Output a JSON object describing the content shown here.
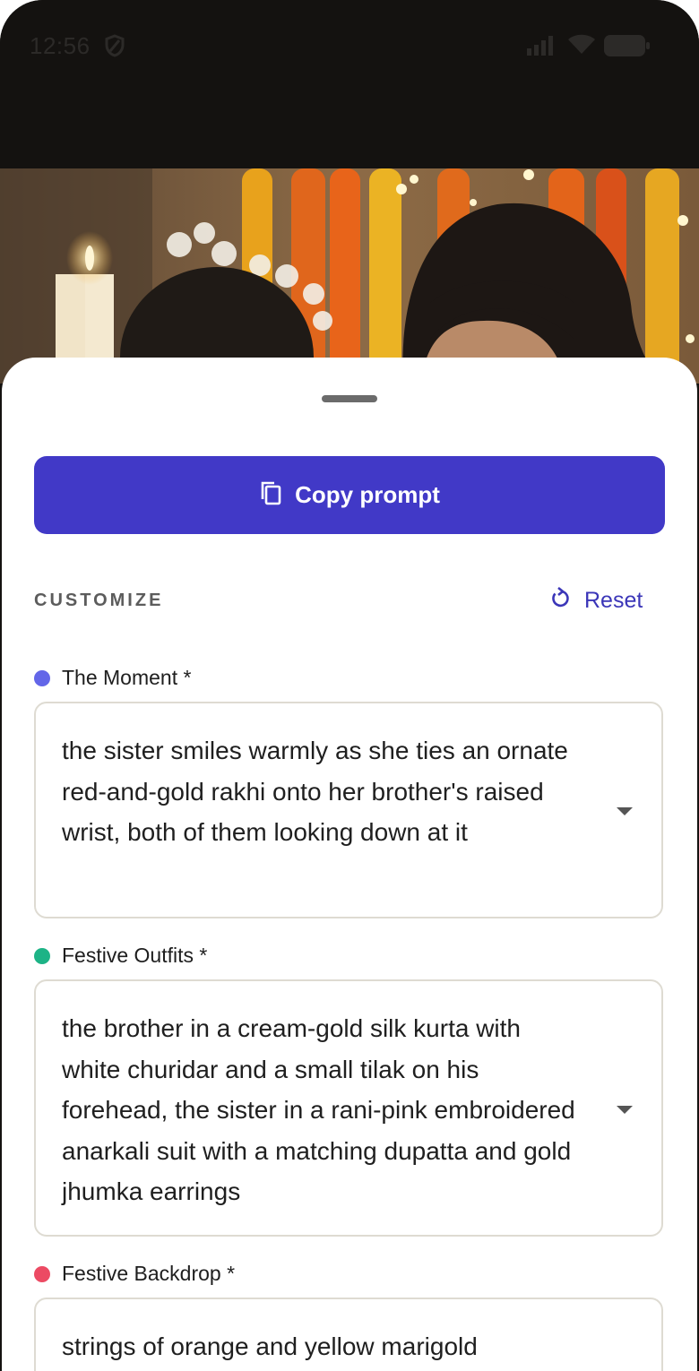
{
  "status": {
    "time": "12:56"
  },
  "actions": {
    "copy_label": "Copy prompt",
    "reset_label": "Reset"
  },
  "section": {
    "title": "CUSTOMIZE"
  },
  "fields": [
    {
      "label": "The Moment *",
      "dot_color": "#6366e8",
      "value": "the sister smiles warmly as she ties an ornate red-and-gold rakhi onto her brother's raised wrist, both of them looking down at it"
    },
    {
      "label": "Festive Outfits *",
      "dot_color": "#1db386",
      "value": "the brother in a cream-gold silk kurta with white churidar and a small tilak on his forehead, the sister in a rani-pink embroidered anarkali suit with a matching dupatta and gold jhumka earrings"
    },
    {
      "label": "Festive Backdrop *",
      "dot_color": "#ec4a63",
      "value": "strings of orange and yellow marigold"
    }
  ],
  "colors": {
    "accent": "#4139c7",
    "accent_text": "#3b36b8"
  }
}
